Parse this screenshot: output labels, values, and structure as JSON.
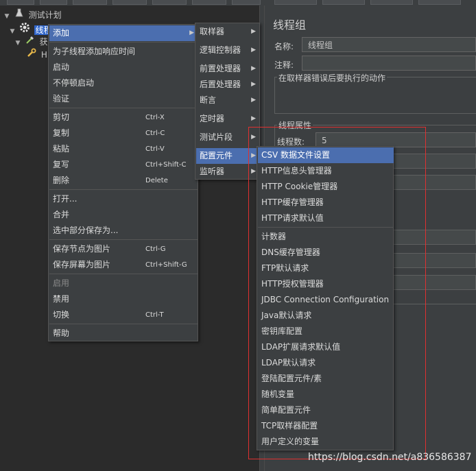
{
  "tree": {
    "root_label": "测试计划",
    "thread_group_label": "线程",
    "child1_label": "获",
    "child2_label": "H"
  },
  "right_panel": {
    "title": "线程组",
    "name_label": "名称:",
    "name_value": "线程组",
    "comment_label": "注释:",
    "comment_value": "",
    "on_error_group_title": "在取样器错误后要执行的动作",
    "thread_props_title": "线程属性",
    "threads_label": "线程数:",
    "threads_value": "5"
  },
  "context_menu": {
    "items": [
      {
        "label": "添加",
        "shortcut": "",
        "submenu": true
      },
      {
        "label": "为子线程添加响应时间",
        "shortcut": ""
      },
      {
        "label": "启动",
        "shortcut": ""
      },
      {
        "label": "不停顿启动",
        "shortcut": ""
      },
      {
        "label": "验证",
        "shortcut": ""
      },
      {
        "label": "剪切",
        "shortcut": "Ctrl-X"
      },
      {
        "label": "复制",
        "shortcut": "Ctrl-C"
      },
      {
        "label": "粘贴",
        "shortcut": "Ctrl-V"
      },
      {
        "label": "复写",
        "shortcut": "Ctrl+Shift-C"
      },
      {
        "label": "删除",
        "shortcut": "Delete"
      },
      {
        "label": "打开...",
        "shortcut": ""
      },
      {
        "label": "合并",
        "shortcut": ""
      },
      {
        "label": "选中部分保存为...",
        "shortcut": ""
      },
      {
        "label": "保存节点为图片",
        "shortcut": "Ctrl-G"
      },
      {
        "label": "保存屏幕为图片",
        "shortcut": "Ctrl+Shift-G"
      },
      {
        "label": "启用",
        "shortcut": "",
        "disabled": true
      },
      {
        "label": "禁用",
        "shortcut": ""
      },
      {
        "label": "切换",
        "shortcut": "Ctrl-T"
      },
      {
        "label": "帮助",
        "shortcut": ""
      }
    ]
  },
  "add_submenu": {
    "items": [
      "取样器",
      "逻辑控制器",
      "前置处理器",
      "后置处理器",
      "断言",
      "定时器",
      "测试片段",
      "配置元件",
      "监听器"
    ]
  },
  "config_submenu": {
    "items": [
      "CSV 数据文件设置",
      "HTTP信息头管理器",
      "HTTP Cookie管理器",
      "HTTP缓存管理器",
      "HTTP请求默认值",
      "计数器",
      "DNS缓存管理器",
      "FTP默认请求",
      "HTTP授权管理器",
      "JDBC Connection Configuration",
      "Java默认请求",
      "密钥库配置",
      "LDAP扩展请求默认值",
      "LDAP默认请求",
      "登陆配置元件/素",
      "随机变量",
      "简单配置元件",
      "TCP取样器配置",
      "用户定义的变量"
    ]
  },
  "watermark": "https://blog.csdn.net/a836586387",
  "colors": {
    "highlight": "#4b6eaf",
    "tree_selection": "#2f65ca",
    "annotation_box": "#e03030"
  }
}
